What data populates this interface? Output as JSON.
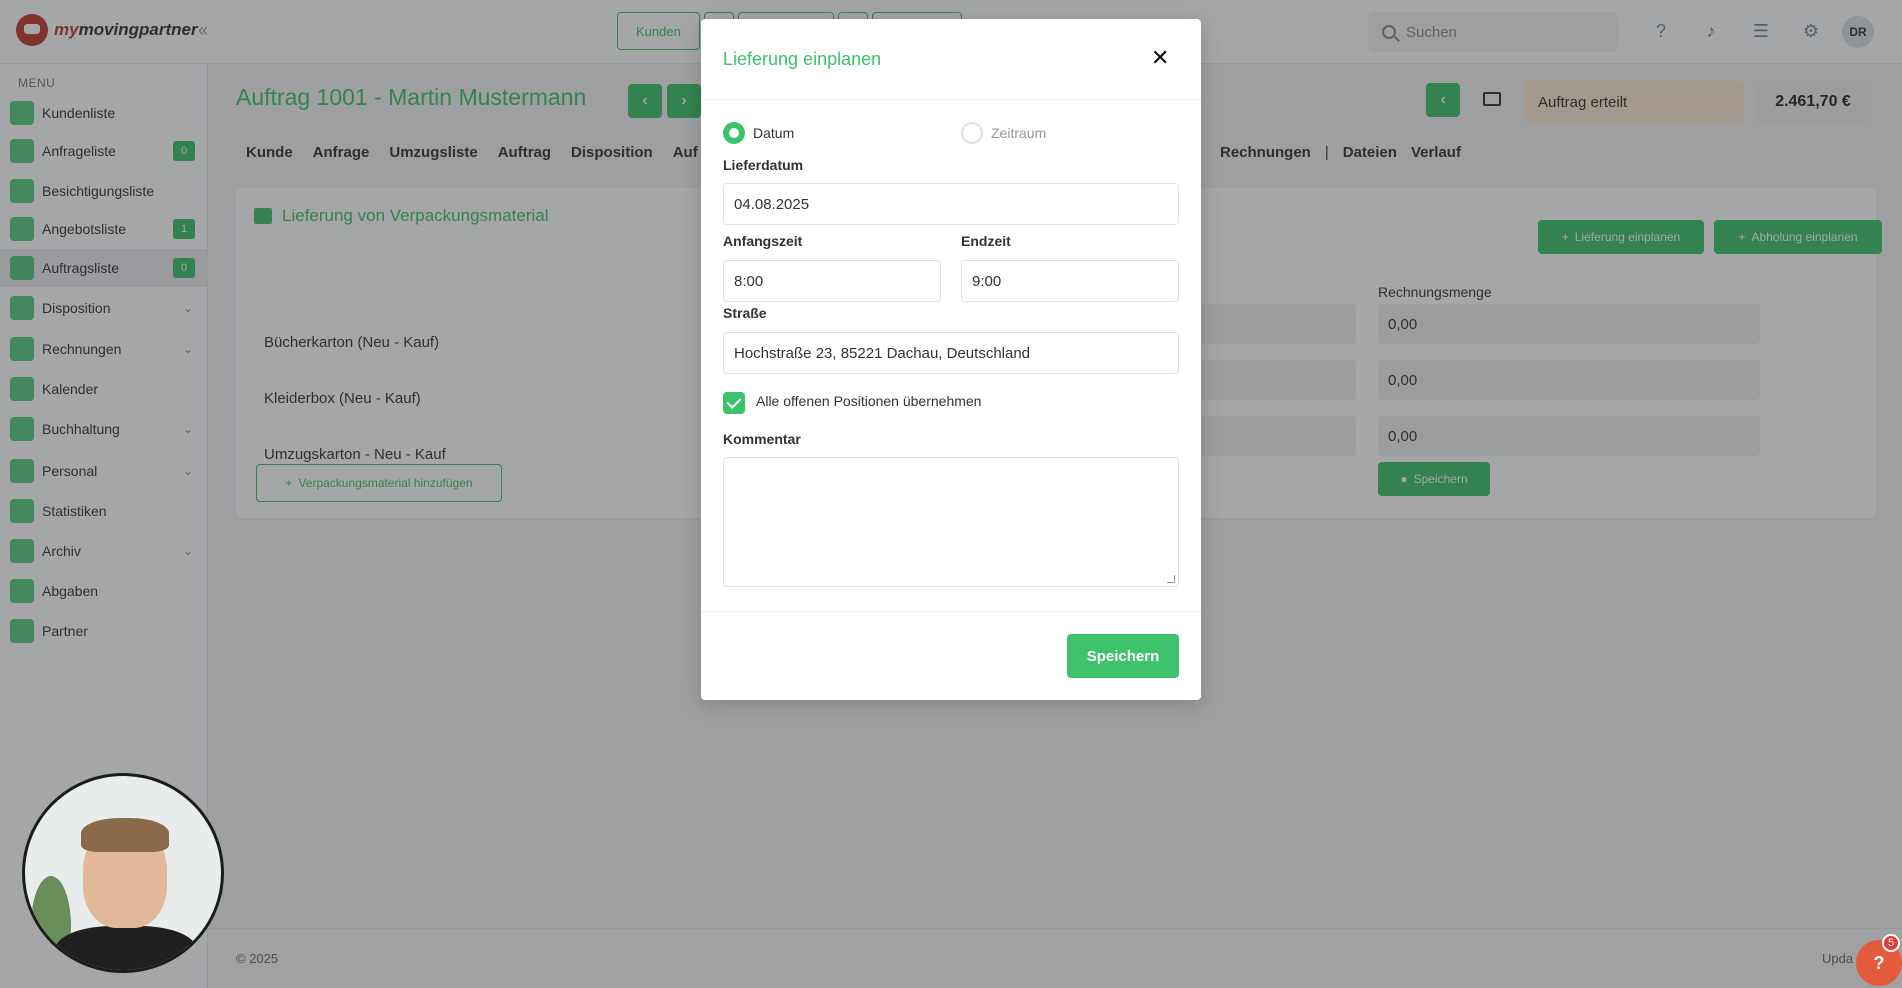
{
  "brand": {
    "prefix": "my",
    "name": "movingpartner"
  },
  "top_tabs": [
    {
      "label": "Kunden"
    }
  ],
  "search": {
    "placeholder": "Suchen"
  },
  "user": {
    "initials": "DR"
  },
  "menu": {
    "label": "MENU",
    "items": [
      {
        "label": "Kundenliste"
      },
      {
        "label": "Anfrageliste",
        "badge": "0"
      },
      {
        "label": "Besichtigungsliste"
      },
      {
        "label": "Angebotsliste",
        "badge": "1"
      },
      {
        "label": "Auftragsliste",
        "badge": "0"
      },
      {
        "label": "Disposition"
      },
      {
        "label": "Rechnungen"
      },
      {
        "label": "Kalender"
      },
      {
        "label": "Buchhaltung"
      },
      {
        "label": "Personal"
      },
      {
        "label": "Statistiken"
      },
      {
        "label": "Archiv"
      },
      {
        "label": "Abgaben"
      },
      {
        "label": "Partner"
      }
    ]
  },
  "order": {
    "title": "Auftrag 1001 - Martin Mustermann",
    "status": "Auftrag erteilt",
    "price": "2.461,70 €"
  },
  "subnav": {
    "left": [
      "Kunde",
      "Anfrage",
      "Umzugsliste",
      "Auftrag",
      "Disposition",
      "Auf"
    ],
    "right": [
      "Rechnungen",
      "|",
      "Dateien",
      "Verlauf"
    ]
  },
  "card": {
    "title": "Lieferung von Verpackungsmaterial",
    "btn_delivery": "Lieferung einplanen",
    "btn_pickup": "Abholung einplanen",
    "col_invoice_qty": "Rechnungsmenge",
    "items": [
      {
        "name": "Bücherkarton (Neu - Kauf)",
        "qty": "0,00"
      },
      {
        "name": "Kleiderbox (Neu - Kauf)",
        "qty": "0,00"
      },
      {
        "name": "Umzugskarton - Neu - Kauf",
        "qty": "0,00"
      }
    ],
    "btn_add": "Verpackungsmaterial hinzufügen",
    "btn_save": "Speichern"
  },
  "footer": {
    "copyright": "© 2025",
    "right": "Upda"
  },
  "modal": {
    "title": "Lieferung einplanen",
    "radio_date": "Datum",
    "radio_range": "Zeitraum",
    "label_date": "Lieferdatum",
    "value_date": "04.08.2025",
    "label_start": "Anfangszeit",
    "value_start": "8:00",
    "label_end": "Endzeit",
    "value_end": "9:00",
    "label_street": "Straße",
    "value_street": "Hochstraße 23, 85221 Dachau, Deutschland",
    "checkbox_label": "Alle offenen Positionen übernehmen",
    "label_comment": "Kommentar",
    "save": "Speichern"
  },
  "help": {
    "label": "?",
    "badge": "5"
  },
  "colors": {
    "accent": "#3ec26b",
    "status_bg": "#fde9d4",
    "help": "#e35a3d"
  }
}
